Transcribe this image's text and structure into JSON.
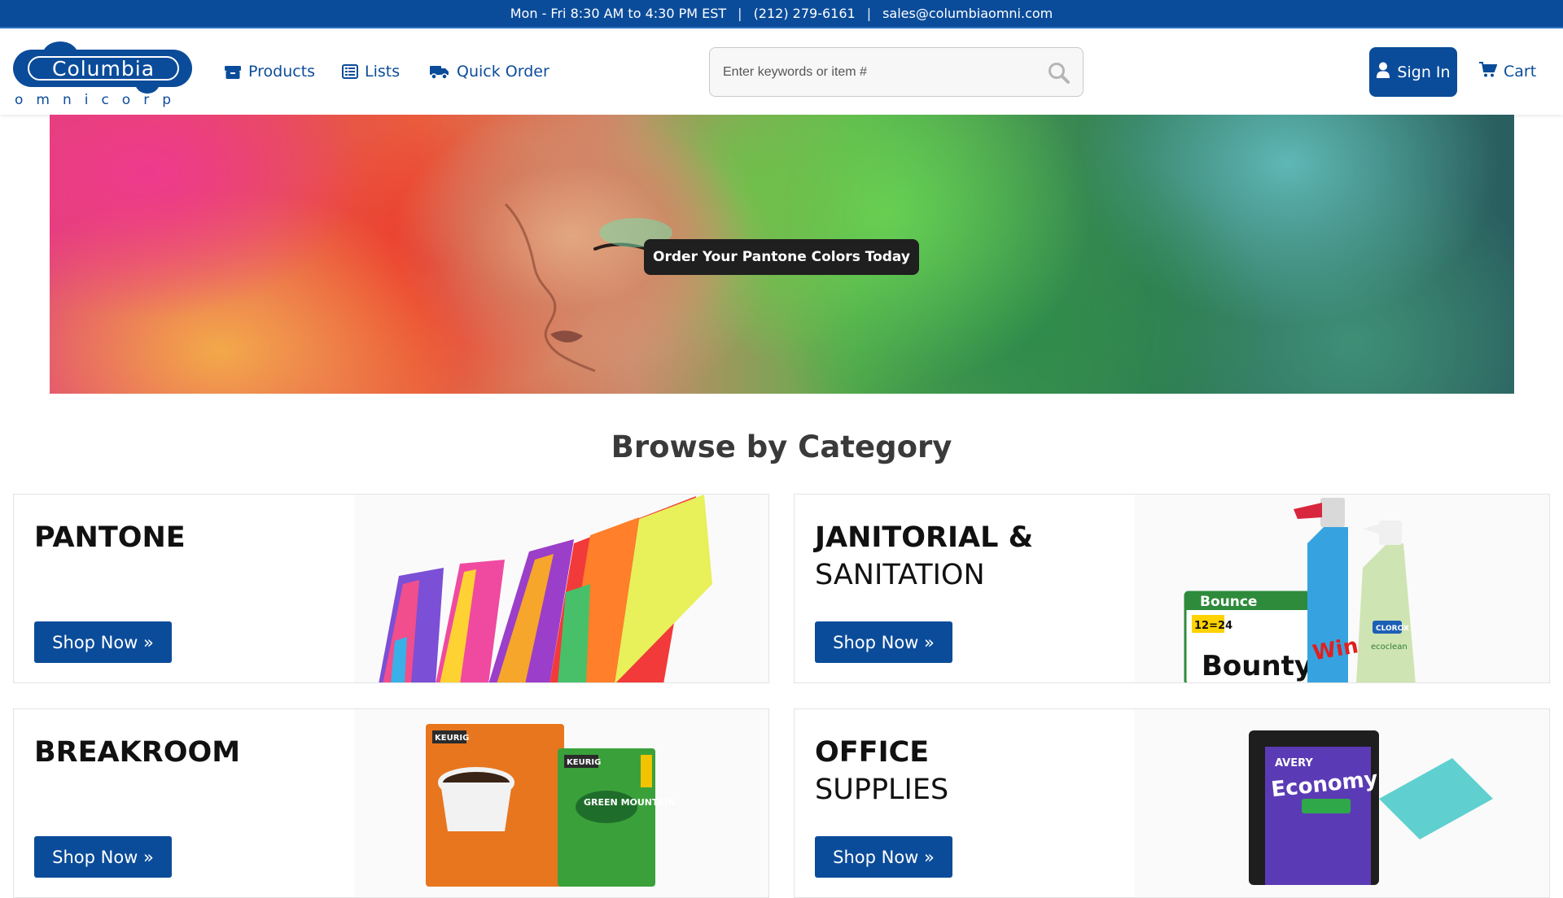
{
  "topbar": {
    "hours": "Mon - Fri 8:30 AM to 4:30 PM EST",
    "phone": "(212) 279-6161",
    "email": "sales@columbiaomni.com",
    "separator": "|"
  },
  "logo": {
    "word": "Columbia",
    "sub": "omnicorp"
  },
  "nav": {
    "products": "Products",
    "lists": "Lists",
    "quick_order": "Quick Order"
  },
  "search": {
    "placeholder": "Enter keywords or item #"
  },
  "account": {
    "sign_in": "Sign In",
    "cart": "Cart"
  },
  "banner": {
    "cta": "Order Your Pantone Colors Today"
  },
  "browse": {
    "title": "Browse by Category",
    "shop_label": "Shop Now »",
    "categories": [
      {
        "line1": "PANTONE",
        "line2": ""
      },
      {
        "line1": "JANITORIAL &",
        "line2": "SANITATION"
      },
      {
        "line1": "BREAKROOM",
        "line2": ""
      },
      {
        "line1": "OFFICE",
        "line2": "SUPPLIES"
      }
    ],
    "product_labels": {
      "bounty": "Bounty",
      "bounce": "Bounce",
      "roll_count": "12=24",
      "windex": "Windex",
      "clorox": "CLOROX",
      "ecoclean": "ecoclean",
      "keurig": "KEURIG",
      "green_mountain": "GREEN MOUNTAIN",
      "avery": "AVERY",
      "economy": "Economy"
    }
  },
  "colors": {
    "brand_blue": "#0b4c9a"
  }
}
